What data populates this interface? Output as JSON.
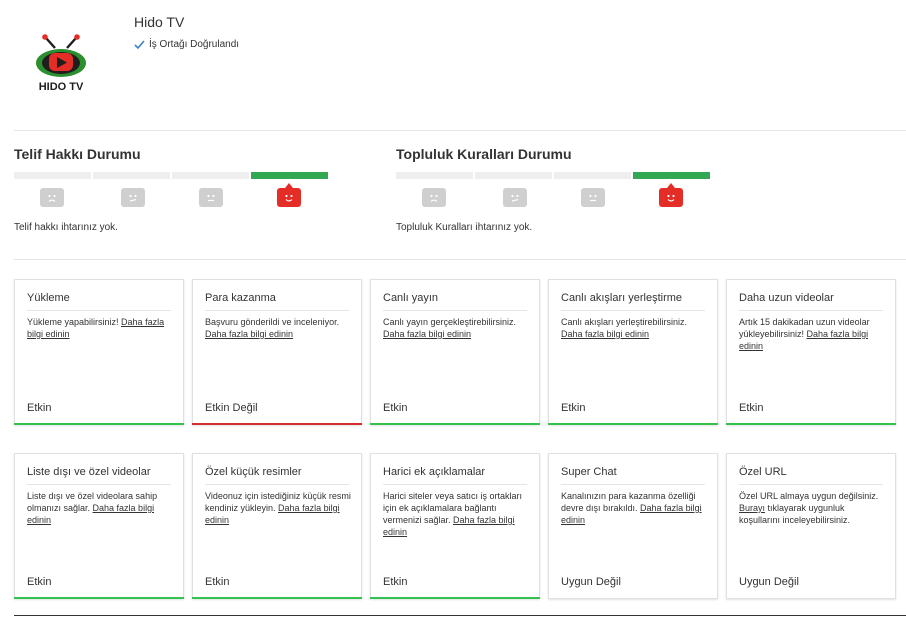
{
  "channel": {
    "name": "Hido TV",
    "verified_label": "İş Ortağı Doğrulandı",
    "logo_text": "HIDO TV"
  },
  "copyright": {
    "title": "Telif Hakkı Durumu",
    "message": "Telif hakkı ihtarınız yok."
  },
  "community": {
    "title": "Topluluk Kuralları Durumu",
    "message": "Topluluk Kuralları ihtarınız yok."
  },
  "colors": {
    "green": "#33a853",
    "red": "#e52d27",
    "inactive": "#cfcfcf"
  },
  "cards": [
    {
      "title": "Yükleme",
      "desc": "Yükleme yapabilirsiniz! ",
      "link": "Daha fazla bilgi edinin",
      "desc_after": "",
      "status": "Etkin",
      "bar": "green"
    },
    {
      "title": "Para kazanma",
      "desc": "Başvuru gönderildi ve inceleniyor. ",
      "link": "Daha fazla bilgi edinin",
      "desc_after": "",
      "status": "Etkin Değil",
      "bar": "red"
    },
    {
      "title": "Canlı yayın",
      "desc": "Canlı yayın gerçekleştirebilirsiniz. ",
      "link": "Daha fazla bilgi edinin",
      "desc_after": "",
      "status": "Etkin",
      "bar": "green"
    },
    {
      "title": "Canlı akışları yerleştirme",
      "desc": "Canlı akışları yerleştirebilirsiniz. ",
      "link": "Daha fazla bilgi edinin",
      "desc_after": "",
      "status": "Etkin",
      "bar": "green"
    },
    {
      "title": "Daha uzun videolar",
      "desc": "Artık 15 dakikadan uzun videolar yükleyebilirsiniz! ",
      "link": "Daha fazla bilgi edinin",
      "desc_after": "",
      "status": "Etkin",
      "bar": "green"
    },
    {
      "title": "Liste dışı ve özel videolar",
      "desc": "Liste dışı ve özel videolara sahip olmanızı sağlar. ",
      "link": "Daha fazla bilgi edinin",
      "desc_after": "",
      "status": "Etkin",
      "bar": "green"
    },
    {
      "title": "Özel küçük resimler",
      "desc": "Videonuz için istediğiniz küçük resmi kendiniz yükleyin. ",
      "link": "Daha fazla bilgi edinin",
      "desc_after": "",
      "status": "Etkin",
      "bar": "green"
    },
    {
      "title": "Harici ek açıklamalar",
      "desc": "Harici siteler veya satıcı iş ortakları için ek açıklamalara bağlantı vermenizi sağlar. ",
      "link": "Daha fazla bilgi edinin",
      "desc_after": "",
      "status": "Etkin",
      "bar": "green"
    },
    {
      "title": "Super Chat",
      "desc": "Kanalınızın para kazanma özelliği devre dışı bırakıldı. ",
      "link": "Daha fazla bilgi edinin",
      "desc_after": "",
      "status": "Uygun Değil",
      "bar": "none"
    },
    {
      "title": "Özel URL",
      "desc": "Özel URL almaya uygun değilsiniz. ",
      "link": "Burayı",
      "desc_after": " tıklayarak uygunluk koşullarını inceleyebilirsiniz.",
      "status": "Uygun Değil",
      "bar": "none"
    }
  ]
}
